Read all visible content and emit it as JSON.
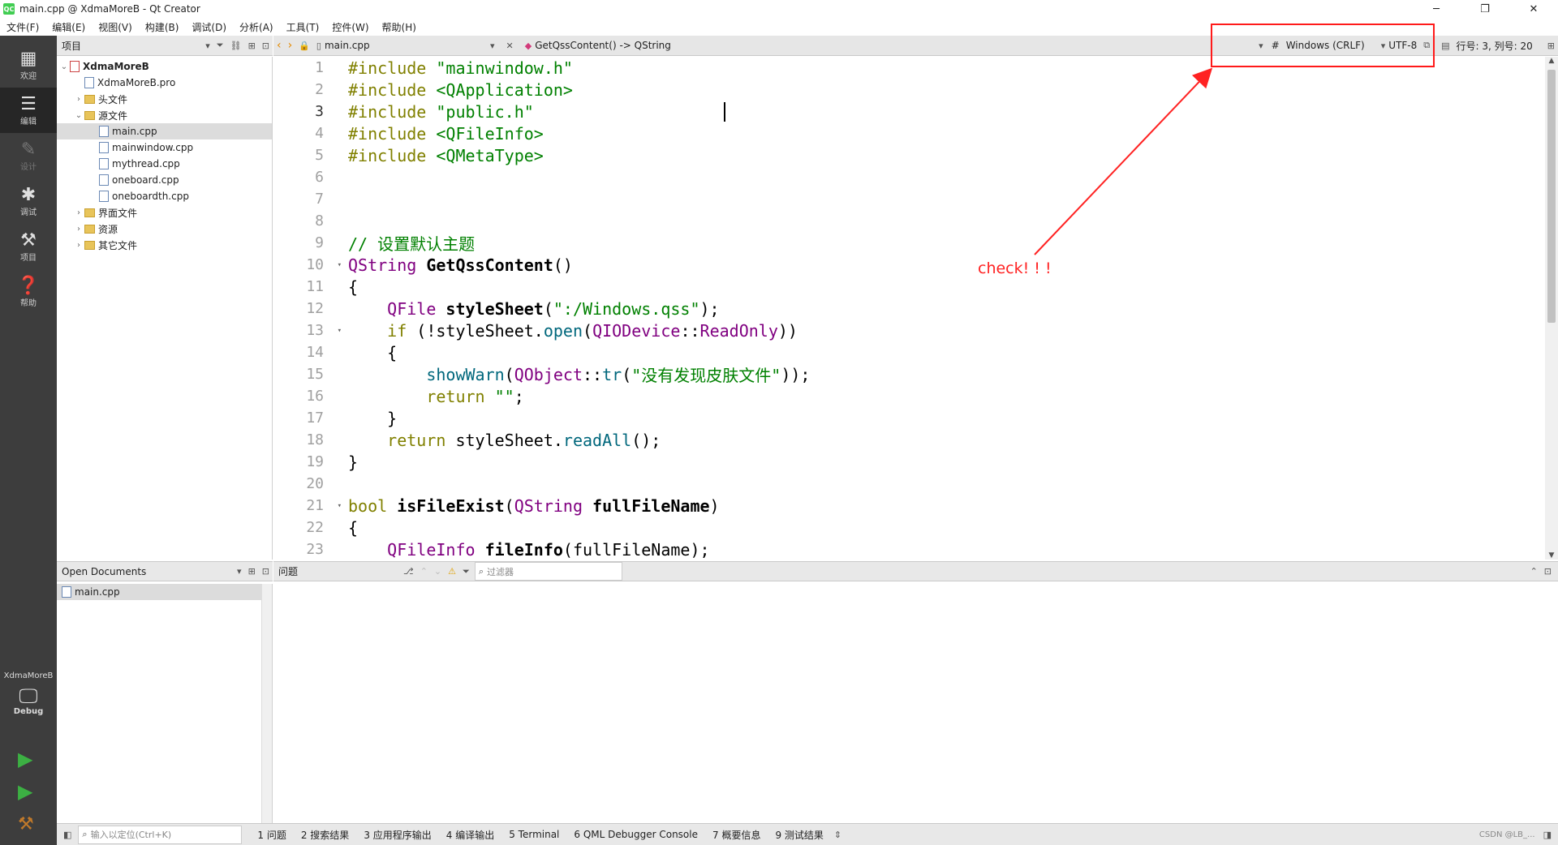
{
  "window": {
    "title": "main.cpp @ XdmaMoreB - Qt Creator",
    "app_icon_text": "QC",
    "controls": [
      "─",
      "❐",
      "✕"
    ]
  },
  "menu": [
    "文件(F)",
    "编辑(E)",
    "视图(V)",
    "构建(B)",
    "调试(D)",
    "分析(A)",
    "工具(T)",
    "控件(W)",
    "帮助(H)"
  ],
  "modes": [
    {
      "label": "欢迎",
      "icon": "grid-icon"
    },
    {
      "label": "编辑",
      "icon": "edit-icon"
    },
    {
      "label": "设计",
      "icon": "pen-icon"
    },
    {
      "label": "调试",
      "icon": "bug-icon"
    },
    {
      "label": "项目",
      "icon": "wrench-icon"
    },
    {
      "label": "帮助",
      "icon": "help-icon"
    }
  ],
  "kit": {
    "project": "XdmaMoreB",
    "config": "Debug"
  },
  "project_panel": {
    "title": "项目",
    "tree": [
      {
        "label": "XdmaMoreB",
        "depth": 0,
        "arrow": "⌄",
        "type": "project"
      },
      {
        "label": "XdmaMoreB.pro",
        "depth": 1,
        "arrow": "",
        "type": "file"
      },
      {
        "label": "头文件",
        "depth": 1,
        "arrow": "›",
        "type": "folder"
      },
      {
        "label": "源文件",
        "depth": 1,
        "arrow": "⌄",
        "type": "folder"
      },
      {
        "label": "main.cpp",
        "depth": 2,
        "arrow": "",
        "type": "file",
        "selected": true
      },
      {
        "label": "mainwindow.cpp",
        "depth": 2,
        "arrow": "",
        "type": "file"
      },
      {
        "label": "mythread.cpp",
        "depth": 2,
        "arrow": "",
        "type": "file"
      },
      {
        "label": "oneboard.cpp",
        "depth": 2,
        "arrow": "",
        "type": "file"
      },
      {
        "label": "oneboardth.cpp",
        "depth": 2,
        "arrow": "",
        "type": "file"
      },
      {
        "label": "界面文件",
        "depth": 1,
        "arrow": "›",
        "type": "folder"
      },
      {
        "label": "资源",
        "depth": 1,
        "arrow": "›",
        "type": "folder"
      },
      {
        "label": "其它文件",
        "depth": 1,
        "arrow": "›",
        "type": "folder"
      }
    ]
  },
  "editor_toolbar": {
    "file": "main.cpp",
    "symbol": "GetQssContent() -> QString",
    "hash": "#",
    "line_ending": "Windows (CRLF)",
    "encoding": "UTF-8",
    "position": "行号: 3, 列号: 20"
  },
  "code": {
    "line_numbers": [
      "1",
      "2",
      "3",
      "4",
      "5",
      "6",
      "7",
      "8",
      "9",
      "10",
      "11",
      "12",
      "13",
      "14",
      "15",
      "16",
      "17",
      "18",
      "19",
      "20",
      "21",
      "22",
      "23"
    ],
    "current_line": 3,
    "fold_lines": [
      10,
      13,
      21
    ],
    "lines": [
      [
        [
          "kw",
          "#include "
        ],
        [
          "str",
          "\"mainwindow.h\""
        ]
      ],
      [
        [
          "kw",
          "#include "
        ],
        [
          "str",
          "<QApplication>"
        ]
      ],
      [
        [
          "kw",
          "#include "
        ],
        [
          "str",
          "\"public.h\""
        ]
      ],
      [
        [
          "kw",
          "#include "
        ],
        [
          "str",
          "<QFileInfo>"
        ]
      ],
      [
        [
          "kw",
          "#include "
        ],
        [
          "str",
          "<QMetaType>"
        ]
      ],
      [],
      [],
      [],
      [
        [
          "cm",
          "// 设置默认主题"
        ]
      ],
      [
        [
          "ty",
          "QString "
        ],
        [
          "bold",
          "GetQssContent"
        ],
        [
          "",
          "()"
        ]
      ],
      [
        [
          "",
          "{"
        ]
      ],
      [
        [
          "",
          "    "
        ],
        [
          "ty",
          "QFile "
        ],
        [
          "bold",
          "styleSheet"
        ],
        [
          "",
          "("
        ],
        [
          "str",
          "\":/Windows.qss\""
        ],
        [
          "",
          ");"
        ]
      ],
      [
        [
          "",
          "    "
        ],
        [
          "kw",
          "if "
        ],
        [
          "",
          "(!styleSheet."
        ],
        [
          "fn",
          "open"
        ],
        [
          "",
          "("
        ],
        [
          "ty",
          "QIODevice"
        ],
        [
          "",
          "::"
        ],
        [
          "ty",
          "ReadOnly"
        ],
        [
          "",
          "))"
        ]
      ],
      [
        [
          "",
          "    {"
        ]
      ],
      [
        [
          "",
          "        "
        ],
        [
          "fn",
          "showWarn"
        ],
        [
          "",
          "("
        ],
        [
          "ty",
          "QObject"
        ],
        [
          "",
          "::"
        ],
        [
          "fn",
          "tr"
        ],
        [
          "",
          "("
        ],
        [
          "str",
          "\"没有发现皮肤文件\""
        ],
        [
          "",
          "));"
        ]
      ],
      [
        [
          "",
          "        "
        ],
        [
          "kw",
          "return "
        ],
        [
          "str",
          "\"\""
        ],
        [
          "",
          ";"
        ]
      ],
      [
        [
          "",
          "    }"
        ]
      ],
      [
        [
          "",
          "    "
        ],
        [
          "kw",
          "return "
        ],
        [
          "",
          "styleSheet."
        ],
        [
          "fn",
          "readAll"
        ],
        [
          "",
          "();"
        ]
      ],
      [
        [
          "",
          "}"
        ]
      ],
      [],
      [
        [
          "kw",
          "bool "
        ],
        [
          "bold",
          "isFileExist"
        ],
        [
          "",
          "("
        ],
        [
          "ty",
          "QString "
        ],
        [
          "bold",
          "fullFileName"
        ],
        [
          "",
          ")"
        ]
      ],
      [
        [
          "",
          "{"
        ]
      ],
      [
        [
          "",
          "    "
        ],
        [
          "ty",
          "QFileInfo "
        ],
        [
          "bold",
          "fileInfo"
        ],
        [
          "",
          "(fullFileName);"
        ]
      ]
    ]
  },
  "open_docs": {
    "title": "Open Documents",
    "items": [
      "main.cpp"
    ]
  },
  "issues": {
    "title": "问题",
    "filter_placeholder": "过滤器"
  },
  "status": {
    "locator_placeholder": "输入以定位(Ctrl+K)",
    "tabs": [
      "1 问题",
      "2 搜索结果",
      "3 应用程序输出",
      "4 编译输出",
      "5 Terminal",
      "6 QML Debugger Console",
      "7 概要信息",
      "9 测试结果"
    ],
    "watermark": "CSDN @LB_..."
  },
  "annotation": {
    "text": "check! ! !",
    "color": "#ff2222"
  }
}
